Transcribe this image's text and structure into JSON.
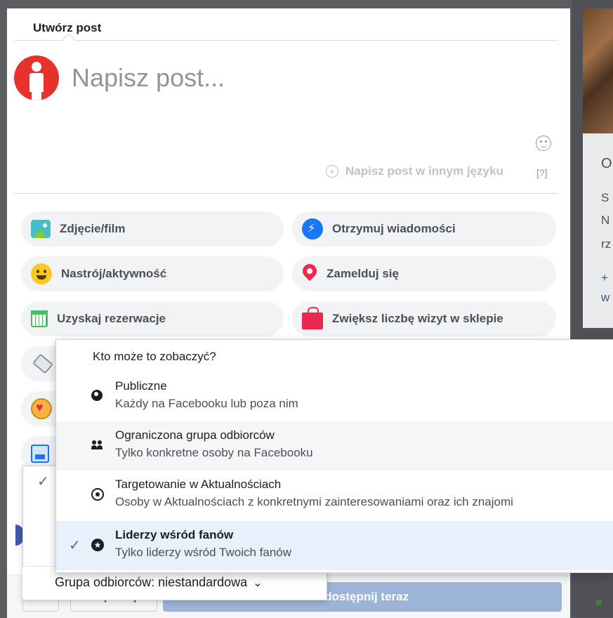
{
  "composer": {
    "tab_title": "Utwórz post",
    "placeholder": "Napisz post...",
    "other_language": "Napisz post w innym języku",
    "help": "[?]"
  },
  "actions": [
    {
      "label": "Zdjęcie/film",
      "icon": "photo-icon"
    },
    {
      "label": "Otrzymuj wiadomości",
      "icon": "messenger-icon"
    },
    {
      "label": "Nastrój/aktywność",
      "icon": "smiley-icon"
    },
    {
      "label": "Zamelduj się",
      "icon": "location-pin-icon"
    },
    {
      "label": "Uzyskaj rezerwacje",
      "icon": "calendar-icon"
    },
    {
      "label": "Zwiększ liczbę wizyt w sklepie",
      "icon": "shopping-bag-icon"
    }
  ],
  "audience_menu": {
    "heading": "Kto może to zobaczyć?",
    "items": [
      {
        "title": "Publiczne",
        "subtitle": "Każdy na Facebooku lub poza nim",
        "icon": "globe-icon",
        "selected": false
      },
      {
        "title": "Ograniczona grupa odbiorców",
        "subtitle": "Tylko konkretne osoby na Facebooku",
        "icon": "people-icon",
        "selected": false
      },
      {
        "title": "Targetowanie w Aktualnościach",
        "subtitle": "Osoby w Aktualnościach z konkretnymi zainteresowaniami oraz ich znajomi",
        "icon": "target-icon",
        "selected": false
      },
      {
        "title": "Liderzy wśród fanów",
        "subtitle": "Tylko liderzy wśród Twoich fanów",
        "icon": "star-badge-icon",
        "selected": true
      }
    ]
  },
  "audience_selector": {
    "label": "Grupa odbiorców: niestandardowa"
  },
  "footer": {
    "schedule": "Zaplanuj",
    "share": "Udostępnij teraz"
  },
  "background": {
    "lines": [
      "O",
      "S",
      "N",
      "rz",
      "+",
      "w"
    ]
  },
  "colors": {
    "primary": "#1877f2",
    "share_disabled": "#9cb4d8",
    "selected_row": "#e7f0fb"
  }
}
